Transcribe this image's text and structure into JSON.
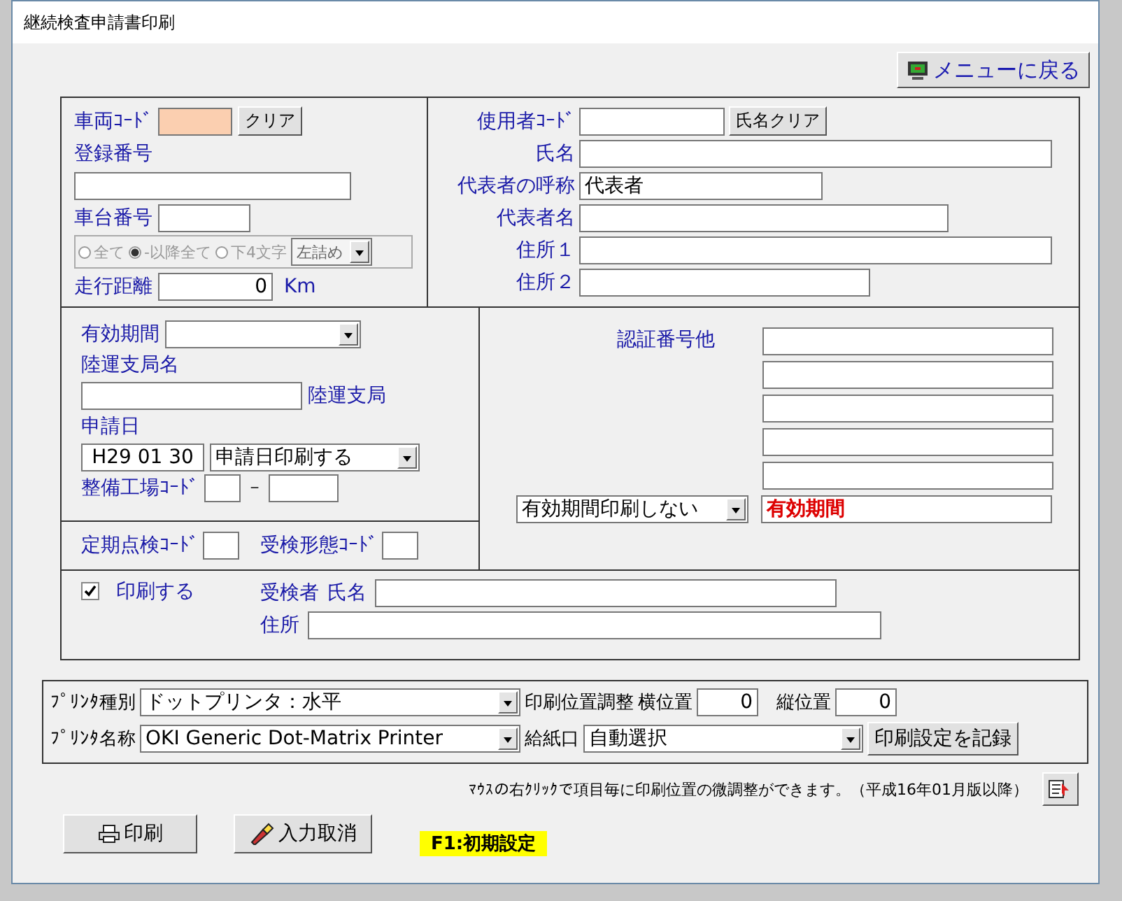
{
  "window": {
    "title": "継続検査申請書印刷"
  },
  "menu_button": {
    "label": "メニューに戻る"
  },
  "vehicle": {
    "code_label": "車両ｺｰﾄﾞ",
    "clear_button": "クリア",
    "registration_label": "登録番号",
    "chassis_label": "車台番号",
    "match_options": [
      {
        "label": "全て",
        "selected": false
      },
      {
        "label": "-以降全て",
        "selected": true
      },
      {
        "label": "下4文字",
        "selected": false
      }
    ],
    "match_disabled": true,
    "align_value": "左詰め",
    "mileage_label": "走行距離",
    "mileage_value": "0",
    "mileage_unit": "Km"
  },
  "user": {
    "code_label": "使用者ｺｰﾄﾞ",
    "clear_button": "氏名クリア",
    "fields": [
      {
        "label": "氏名"
      },
      {
        "label": "代表者の呼称",
        "value": "代表者"
      },
      {
        "label": "代表者名"
      },
      {
        "label": "住所１"
      },
      {
        "label": "住所２"
      }
    ]
  },
  "application": {
    "validity_label": "有効期間",
    "office_label": "陸運支局名",
    "office_suffix": "陸運支局",
    "date_label": "申請日",
    "date_value": "H29 01 30",
    "date_print": "申請日印刷する",
    "garage_label": "整備工場ｺｰﾄﾞ",
    "garage_separator": "－",
    "periodic_label": "定期点検ｺｰﾄﾞ",
    "exam_type_label": "受検形態ｺｰﾄﾞ"
  },
  "certification": {
    "label": "認証番号他",
    "validity_print": "有効期間印刷しない",
    "validity_value": "有効期間"
  },
  "examinee": {
    "print": {
      "label": "印刷する",
      "checked": true
    },
    "label": "受検者",
    "name_label": "氏名",
    "address_label": "住所"
  },
  "printer": {
    "type_label": "ﾌﾟﾘﾝﾀ種別",
    "type_value": "ドットプリンタ：水平",
    "name_label": "ﾌﾟﾘﾝﾀ名称",
    "name_value": "OKI Generic Dot-Matrix Printer",
    "adjust_label": "印刷位置調整",
    "horizontal_label": "横位置",
    "horizontal_value": "0",
    "vertical_label": "縦位置",
    "vertical_value": "0",
    "tray_label": "給紙口",
    "tray_value": "自動選択",
    "save_button": "印刷設定を記録"
  },
  "note": "ﾏｳｽの右ｸﾘｯｸで項目毎に印刷位置の微調整ができます。（平成16年01月版以降）",
  "buttons": [
    {
      "label": "印刷",
      "kind": "print"
    },
    {
      "label": "入力取消",
      "kind": "cancel"
    }
  ],
  "hint": "F1:初期設定"
}
